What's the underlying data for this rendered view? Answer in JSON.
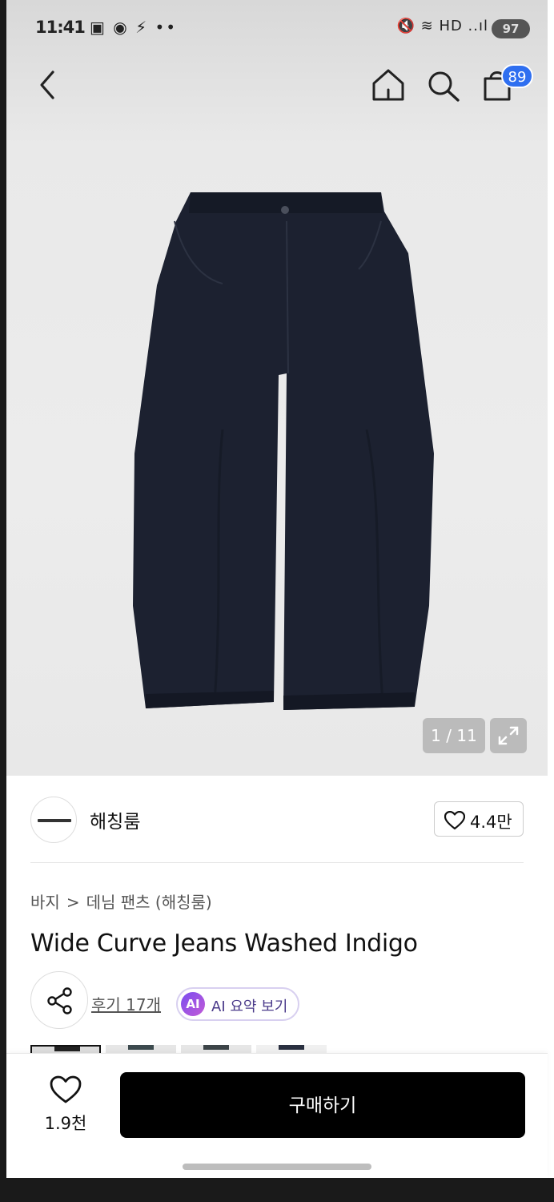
{
  "status_bar": {
    "time": "11:41",
    "left_icons": "▣ ◉ ⚡ ••",
    "right_icons": "🔇 ≋ HD ..ıl",
    "battery": "97"
  },
  "nav": {
    "back_icon": "chevron-left-icon",
    "home_icon": "home-icon",
    "search_icon": "search-icon",
    "cart_icon": "shopping-bag-icon",
    "cart_count": "89"
  },
  "gallery": {
    "counter": "1 / 11",
    "expand_icon": "expand-icon",
    "product_color": "#1c2130"
  },
  "store": {
    "name": "해칭룸",
    "likes": "4.4만"
  },
  "breadcrumb": {
    "category": "바지",
    "separator": ">",
    "subcategory": "데님 팬츠 (해칭룸)"
  },
  "product": {
    "title": "Wide Curve Jeans Washed Indigo",
    "reviews": "후기 17개",
    "ai_badge": "AI",
    "ai_summary": "AI 요약 보기"
  },
  "bottom_bar": {
    "wish_count": "1.9천",
    "buy_label": "구매하기"
  },
  "colors": {
    "accent_badge": "#2f6ff0",
    "buy_button": "#000000"
  }
}
